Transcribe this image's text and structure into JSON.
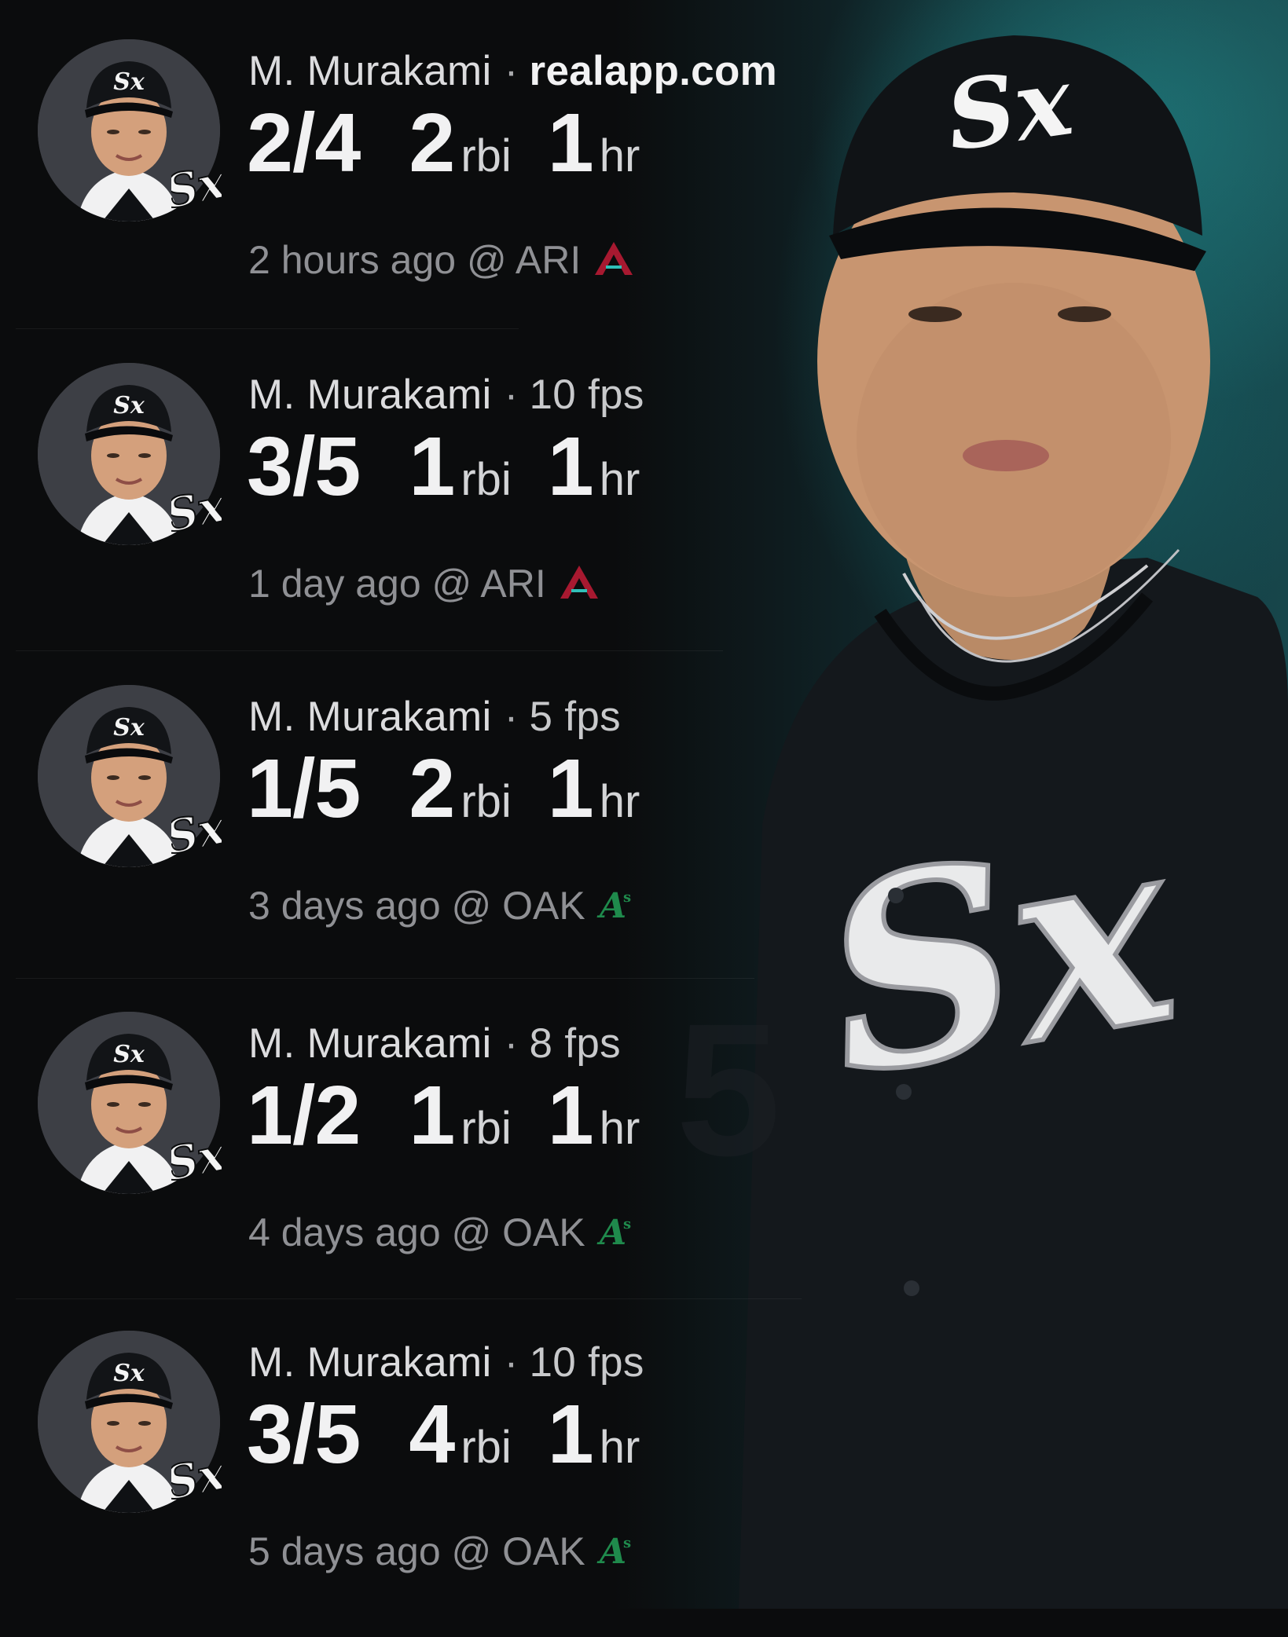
{
  "source": "realapp.com",
  "player_name": "M. Murakami",
  "separator": "·",
  "units": {
    "rbi": "rbi",
    "hr": "hr"
  },
  "games": [
    {
      "meta": "realapp.com",
      "meta_strong": true,
      "hits": "2/4",
      "rbi": "2",
      "hr": "1",
      "when": "2 hours ago @ ARI",
      "opp": "ARI",
      "opp_logo": "diamondbacks-logo"
    },
    {
      "meta": "10 fps",
      "meta_strong": false,
      "hits": "3/5",
      "rbi": "1",
      "hr": "1",
      "when": "1 day ago @ ARI",
      "opp": "ARI",
      "opp_logo": "diamondbacks-logo"
    },
    {
      "meta": "5 fps",
      "meta_strong": false,
      "hits": "1/5",
      "rbi": "2",
      "hr": "1",
      "when": "3 days ago @ OAK",
      "opp": "OAK",
      "opp_logo": "athletics-logo"
    },
    {
      "meta": "8 fps",
      "meta_strong": false,
      "hits": "1/2",
      "rbi": "1",
      "hr": "1",
      "when": "4 days ago @ OAK",
      "opp": "OAK",
      "opp_logo": "athletics-logo"
    },
    {
      "meta": "10 fps",
      "meta_strong": false,
      "hits": "3/5",
      "rbi": "4",
      "hr": "1",
      "when": "5 days ago @ OAK",
      "opp": "OAK",
      "opp_logo": "athletics-logo"
    }
  ],
  "colors": {
    "background": "#0b0c0d",
    "accent_teal": "#17464b",
    "diamondbacks": "#a71930",
    "athletics": "#1f8a4c"
  }
}
